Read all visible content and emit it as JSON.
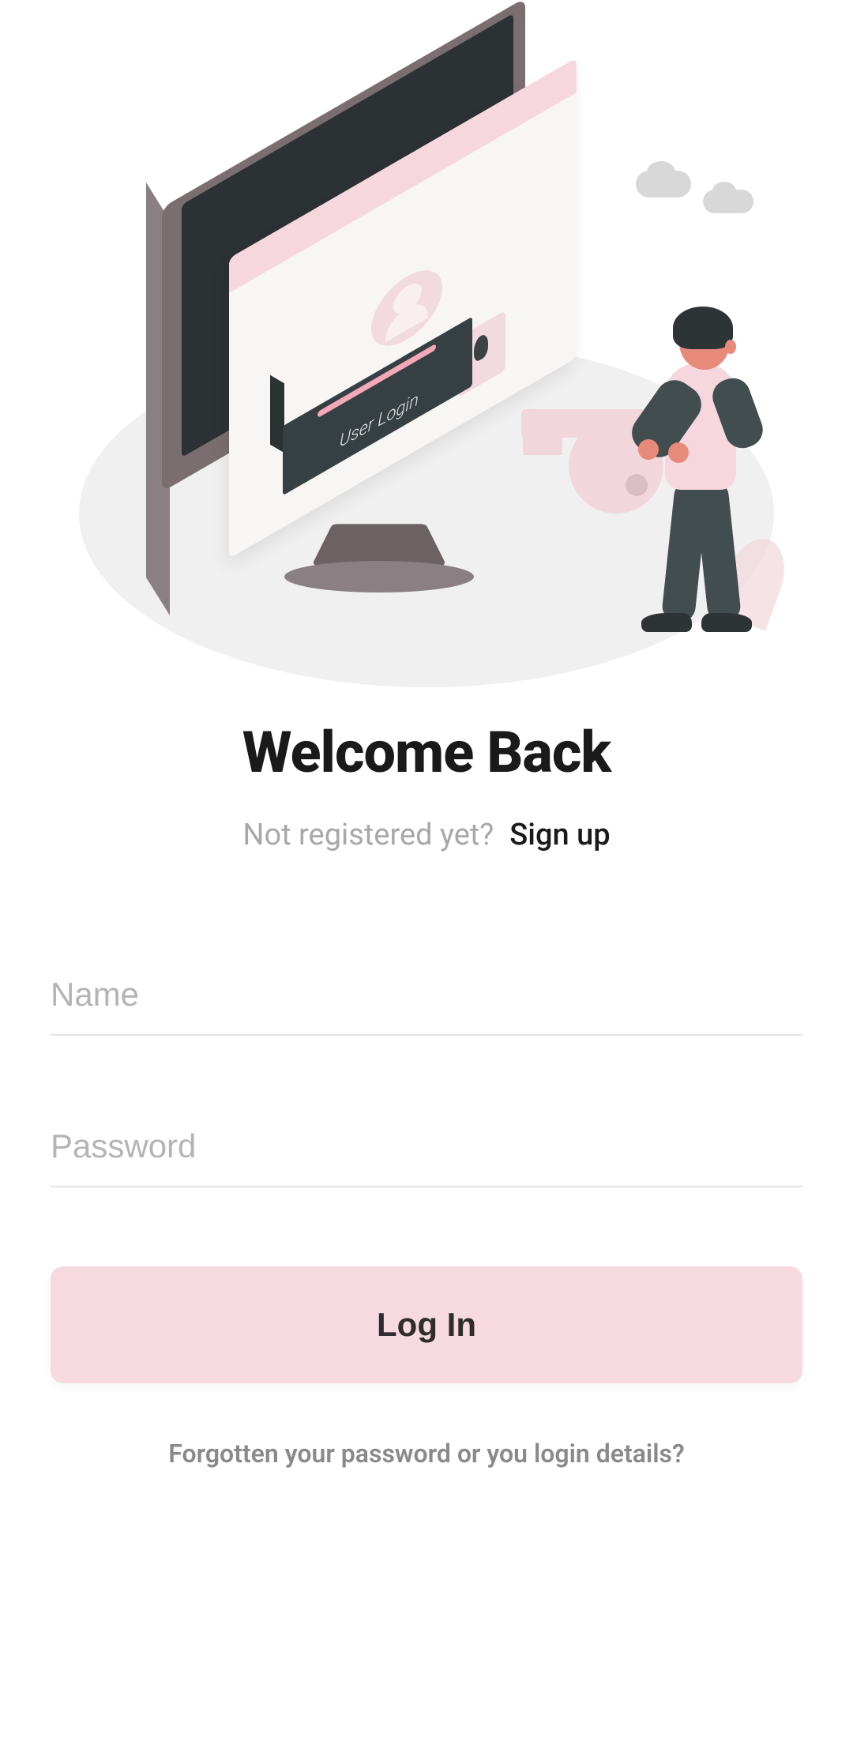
{
  "illustration": {
    "login_box_label": "User Login"
  },
  "header": {
    "title": "Welcome Back",
    "subtitle_prompt": "Not registered yet?",
    "signup_link": "Sign up"
  },
  "form": {
    "name_placeholder": "Name",
    "name_value": "",
    "password_placeholder": "Password",
    "password_value": "",
    "login_button_label": "Log In"
  },
  "footer": {
    "forgot_text": "Forgotten your password or you login details?"
  },
  "colors": {
    "accent": "#f7d9e0",
    "text_primary": "#1a1a1a",
    "text_muted": "#a8a8a8"
  }
}
